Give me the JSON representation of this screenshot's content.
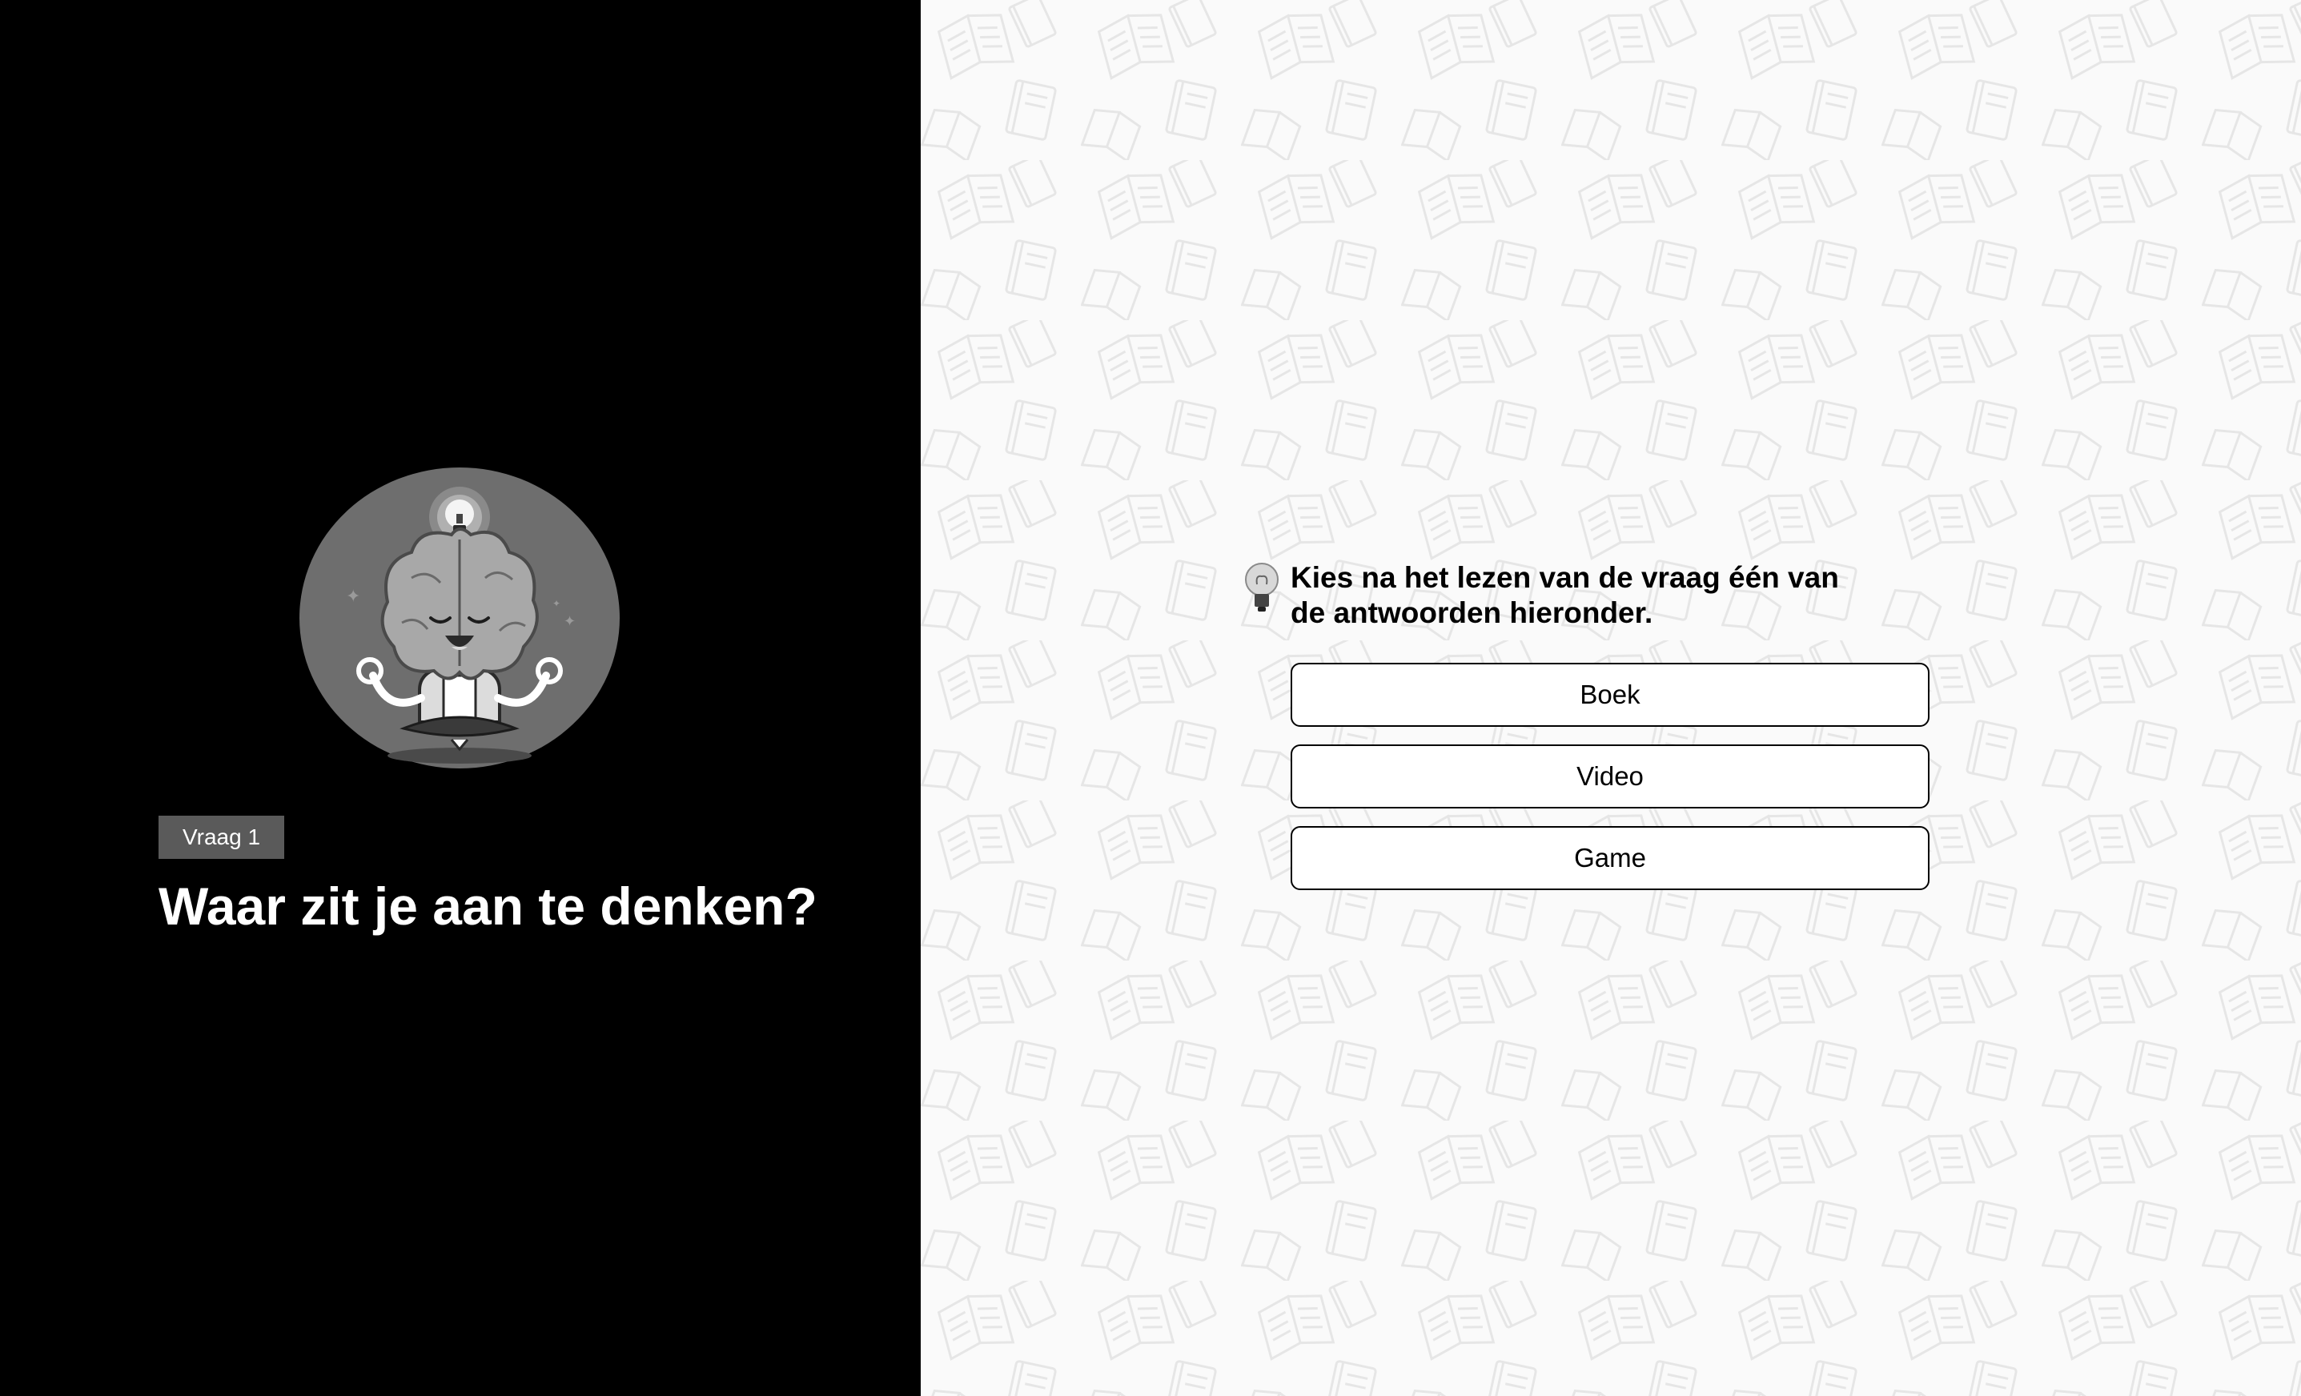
{
  "left_panel": {
    "badge": "Vraag 1",
    "question": "Waar zit je aan te denken?",
    "illustration_icon": "meditating-brain-lightbulb"
  },
  "right_panel": {
    "background_pattern_icon": "book-icon",
    "instruction_icon": "lightbulb-icon",
    "instruction": "Kies na het lezen van de vraag één van de antwoorden hieronder.",
    "answers": [
      {
        "label": "Boek"
      },
      {
        "label": "Video"
      },
      {
        "label": "Game"
      }
    ]
  },
  "colors": {
    "left_background": "#000000",
    "right_background": "#fafafa",
    "badge_background": "#5a5a5a",
    "button_border": "#000000"
  }
}
